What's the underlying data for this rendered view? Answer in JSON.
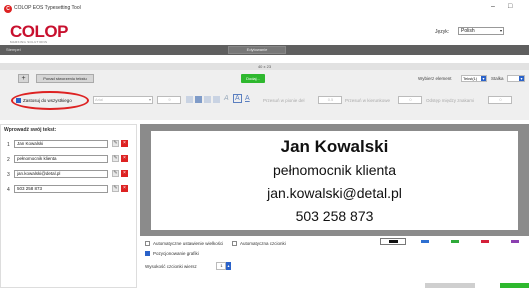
{
  "window": {
    "logo_letter": "C",
    "title": "COLOP EOS Typesetting Tool",
    "min_glyph": "–",
    "max_glyph": "□"
  },
  "brand": {
    "name": "COLOP",
    "subtitle": "MARKING SOLUTIONS",
    "color": "#c8102e"
  },
  "language": {
    "label": "Język:",
    "value": "Polish"
  },
  "topnav": {
    "tab_left": "Stempel",
    "tab_selected": "Edytowanie"
  },
  "size_strip": {
    "text": "40 x 23"
  },
  "toolbar": {
    "plus_glyph": "+",
    "clear_all_label": "Ponad stworzeniu tekstu",
    "green_button_label": "Dodaj...",
    "select_element_label": "Wybierz element",
    "select_element_value": "Tekst(1)",
    "style_label": "Stalka",
    "apply_all_label": "Zastosuj do wszystkiego",
    "apply_all_checked": true,
    "font_value": "Arial",
    "size_value": "9",
    "letter_a_outline": "A",
    "letter_a_box": "A",
    "letter_a_under": "A",
    "spacing_label": "Przesuń w pionie del",
    "spacing_value": "0.5",
    "horizontal_label": "Przesuń w kierunkowe",
    "horizontal_value": "0",
    "bottom_label": "Odstęp między znakami",
    "bottom_value": "0"
  },
  "lines_panel": {
    "header": "Wprowadź swój tekst:",
    "edit_glyph": "✎",
    "delete_glyph": "×",
    "rows": [
      {
        "num": "1",
        "value": "Jan Kowalski"
      },
      {
        "num": "2",
        "value": "pełnomocnik klienta"
      },
      {
        "num": "3",
        "value": "jan.kowalski@detal.pl"
      },
      {
        "num": "4",
        "value": "503 258 873"
      }
    ]
  },
  "preview": {
    "line1": "Jan Kowalski",
    "line2": "pełnomocnik klienta",
    "line3": "jan.kowalski@detal.pl",
    "line4": "503 258 873"
  },
  "options": {
    "auto_size_label": "Automatyczne ustawienie wielkości",
    "auto_size_checked": false,
    "auto_bold_label": "Automatyczna czcionki",
    "auto_bold_checked": false,
    "position_graphics_label": "Pozycjonowanie grafiki",
    "position_graphics_checked": true,
    "default_height_label": "Wysokość czcionki wiersz",
    "default_height_value": "1"
  },
  "ink_colors": [
    {
      "name": "black",
      "hex": "#111111"
    },
    {
      "name": "blue",
      "hex": "#2e6fd1"
    },
    {
      "name": "green",
      "hex": "#2faa3a"
    },
    {
      "name": "red",
      "hex": "#d4203a"
    },
    {
      "name": "purple",
      "hex": "#8b3fb0"
    }
  ]
}
